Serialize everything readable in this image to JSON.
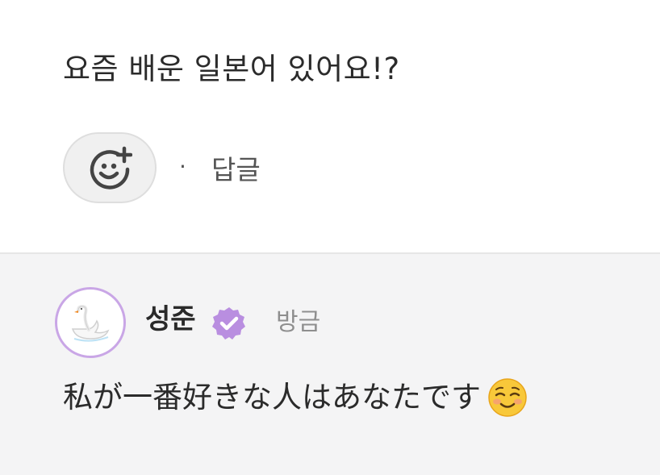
{
  "comment": {
    "text": "요즘 배운 일본어 있어요!?",
    "reply_label": "답글",
    "separator": "·",
    "add_reaction_icon": "smile-plus-icon"
  },
  "reply": {
    "author": "성준",
    "verified_icon": "verified-badge-icon",
    "avatar_icon": "swan-icon",
    "timestamp": "방금",
    "text": "私が一番好きな人はあなたです",
    "emoji_icon": "smiling-face-icon"
  },
  "colors": {
    "accent": "#c9a6e6",
    "badge": "#b98ee0",
    "reply_background": "#f4f4f5"
  }
}
